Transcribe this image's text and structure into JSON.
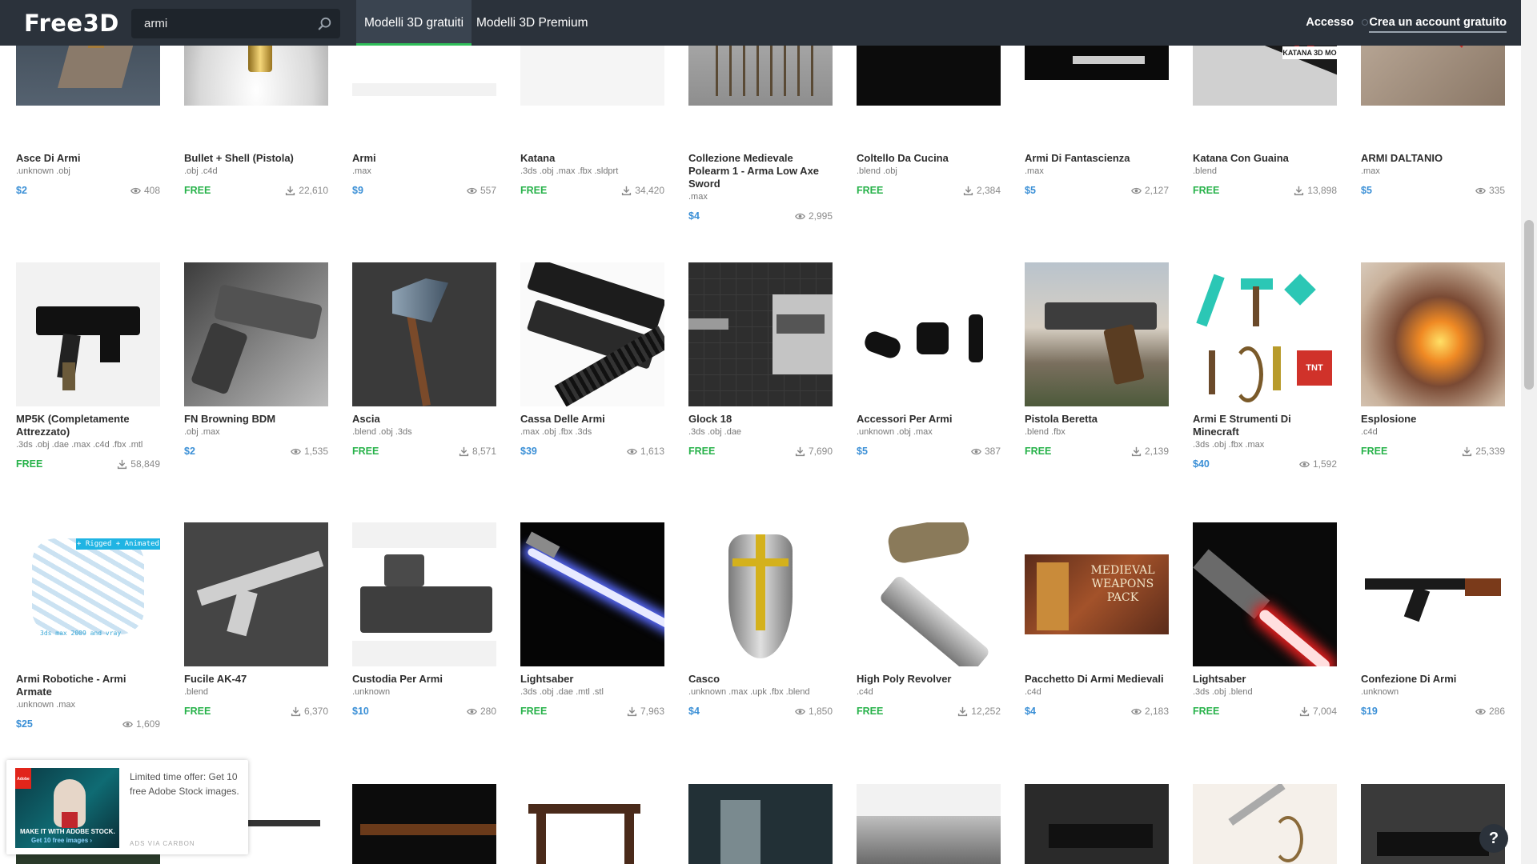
{
  "header": {
    "logo": "Free3D",
    "search": {
      "value": "armi",
      "placeholder": ""
    },
    "tabs": [
      {
        "label": "Modelli 3D gratuiti"
      },
      {
        "label": "Modelli 3D Premium"
      }
    ],
    "login": "Accesso",
    "signup": "Crea un account gratuito",
    "accent_color": "#2fbe59"
  },
  "models": [
    {
      "title": "Asce Di Armi",
      "formats": ".unknown .obj",
      "price": "$2",
      "stat_icon": "eye-icon",
      "stat": "408"
    },
    {
      "title": "Bullet + Shell (Pistola)",
      "formats": ".obj .c4d",
      "price": "FREE",
      "stat_icon": "download-icon",
      "stat": "22,610"
    },
    {
      "title": "Armi",
      "formats": ".max",
      "price": "$9",
      "stat_icon": "eye-icon",
      "stat": "557"
    },
    {
      "title": "Katana",
      "formats": ".3ds .obj .max .fbx .sldprt",
      "price": "FREE",
      "stat_icon": "download-icon",
      "stat": "34,420"
    },
    {
      "title": "Collezione Medievale Polearm 1 - Arma Low Axe Sword",
      "formats": ".max",
      "price": "$4",
      "stat_icon": "eye-icon",
      "stat": "2,995"
    },
    {
      "title": "Coltello Da Cucina",
      "formats": ".blend .obj",
      "price": "FREE",
      "stat_icon": "download-icon",
      "stat": "2,384"
    },
    {
      "title": "Armi Di Fantascienza",
      "formats": ".max",
      "price": "$5",
      "stat_icon": "eye-icon",
      "stat": "2,127"
    },
    {
      "title": "Katana Con Guaina",
      "formats": ".blend",
      "price": "FREE",
      "stat_icon": "download-icon",
      "stat": "13,898"
    },
    {
      "title": "ARMI DALTANIO",
      "formats": ".max",
      "price": "$5",
      "stat_icon": "eye-icon",
      "stat": "335"
    },
    {
      "title": "MP5K (Completamente Attrezzato)",
      "formats": ".3ds .obj .dae .max .c4d .fbx .mtl",
      "price": "FREE",
      "stat_icon": "download-icon",
      "stat": "58,849"
    },
    {
      "title": "FN Browning BDM",
      "formats": ".obj .max",
      "price": "$2",
      "stat_icon": "eye-icon",
      "stat": "1,535"
    },
    {
      "title": "Ascia",
      "formats": ".blend .obj .3ds",
      "price": "FREE",
      "stat_icon": "download-icon",
      "stat": "8,571"
    },
    {
      "title": "Cassa Delle Armi",
      "formats": ".max .obj .fbx .3ds",
      "price": "$39",
      "stat_icon": "eye-icon",
      "stat": "1,613"
    },
    {
      "title": "Glock 18",
      "formats": ".3ds .obj .dae",
      "price": "FREE",
      "stat_icon": "download-icon",
      "stat": "7,690"
    },
    {
      "title": "Accessori Per Armi",
      "formats": ".unknown .obj .max",
      "price": "$5",
      "stat_icon": "eye-icon",
      "stat": "387"
    },
    {
      "title": "Pistola Beretta",
      "formats": ".blend .fbx",
      "price": "FREE",
      "stat_icon": "download-icon",
      "stat": "2,139"
    },
    {
      "title": "Armi E Strumenti Di Minecraft",
      "formats": ".3ds .obj .fbx .max",
      "price": "$40",
      "stat_icon": "eye-icon",
      "stat": "1,592"
    },
    {
      "title": "Esplosione",
      "formats": ".c4d",
      "price": "FREE",
      "stat_icon": "download-icon",
      "stat": "25,339"
    },
    {
      "title": "Armi Robotiche - Armi Armate",
      "formats": ".unknown .max",
      "price": "$25",
      "stat_icon": "eye-icon",
      "stat": "1,609"
    },
    {
      "title": "Fucile AK-47",
      "formats": ".blend",
      "price": "FREE",
      "stat_icon": "download-icon",
      "stat": "6,370"
    },
    {
      "title": "Custodia Per Armi",
      "formats": ".unknown",
      "price": "$10",
      "stat_icon": "eye-icon",
      "stat": "280"
    },
    {
      "title": "Lightsaber",
      "formats": ".3ds .obj .dae .mtl .stl",
      "price": "FREE",
      "stat_icon": "download-icon",
      "stat": "7,963"
    },
    {
      "title": "Casco",
      "formats": ".unknown .max .upk .fbx .blend",
      "price": "$4",
      "stat_icon": "eye-icon",
      "stat": "1,850"
    },
    {
      "title": "High Poly Revolver",
      "formats": ".c4d",
      "price": "FREE",
      "stat_icon": "download-icon",
      "stat": "12,252"
    },
    {
      "title": "Pacchetto Di Armi Medievali",
      "formats": ".c4d",
      "price": "$4",
      "stat_icon": "eye-icon",
      "stat": "2,183"
    },
    {
      "title": "Lightsaber",
      "formats": ".3ds .obj .blend",
      "price": "FREE",
      "stat_icon": "download-icon",
      "stat": "7,004"
    },
    {
      "title": "Confezione Di Armi",
      "formats": ".unknown",
      "price": "$19",
      "stat_icon": "eye-icon",
      "stat": "286"
    }
  ],
  "thumb_labels": {
    "katana_guaina": "KATANA 3D MO",
    "robot_badge": "+ Rigged + Animated",
    "robot_caption": "3ds max 2009 and vray",
    "medieval_pack": "MEDIEVAL WEAPONS PACK",
    "tnt": "TNT"
  },
  "ad": {
    "text": "Limited time offer: Get 10 free Adobe Stock images.",
    "image_line1": "MAKE IT WITH ADOBE STOCK.",
    "image_line2": "Get 10 free images ›",
    "logo_text": "Adobe",
    "via": "ADS VIA CARBON"
  },
  "help_button": "?"
}
